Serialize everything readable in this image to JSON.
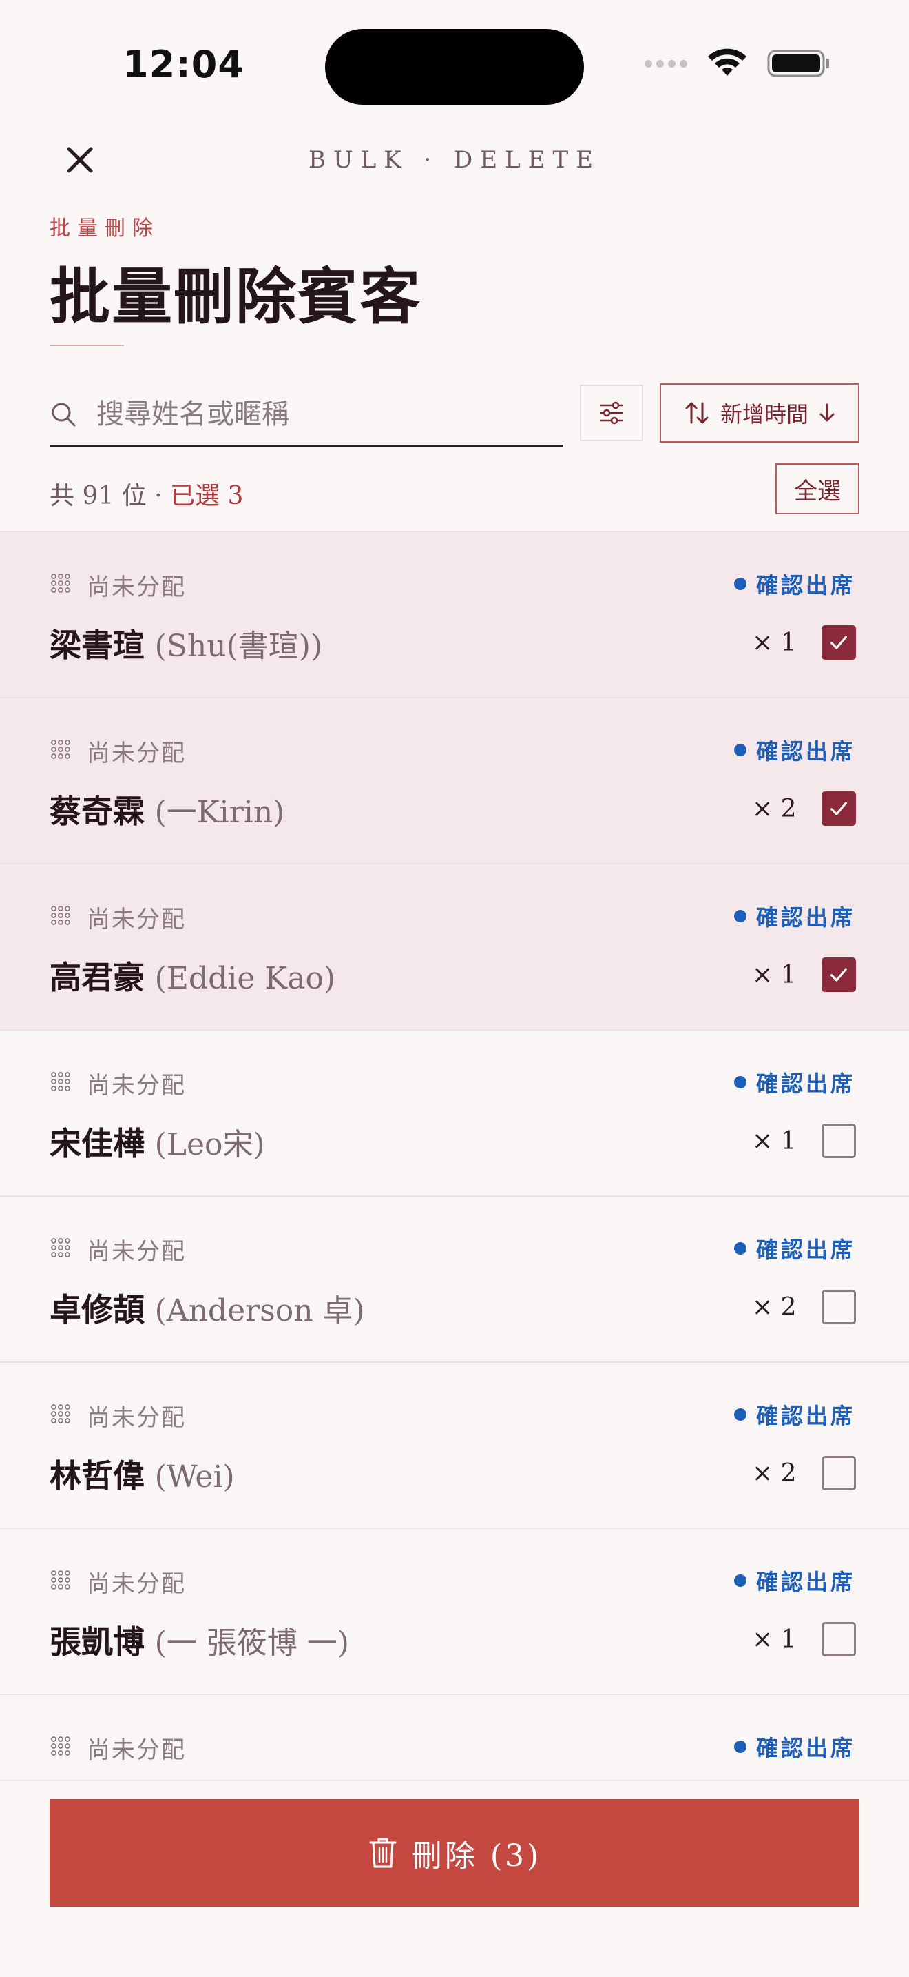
{
  "status_bar": {
    "time": "12:04"
  },
  "header": {
    "eyebrow": "BULK · DELETE",
    "subtitle": "批量刪除",
    "title": "批量刪除賓客"
  },
  "search": {
    "placeholder": "搜尋姓名或暱稱",
    "value": ""
  },
  "sort": {
    "label": "新增時間"
  },
  "summary": {
    "total_text": "共 91 位 · ",
    "selected_text": "已選 3"
  },
  "select_all_label": "全選",
  "guests": [
    {
      "table": "尚未分配",
      "status": "確認出席",
      "name": "梁書瑄",
      "nickname": "(Shu(書瑄))",
      "qty": "× 1",
      "selected": true
    },
    {
      "table": "尚未分配",
      "status": "確認出席",
      "name": "蔡奇霖",
      "nickname": "(一Kirin)",
      "qty": "× 2",
      "selected": true
    },
    {
      "table": "尚未分配",
      "status": "確認出席",
      "name": "高君豪",
      "nickname": "(Eddie Kao)",
      "qty": "× 1",
      "selected": true
    },
    {
      "table": "尚未分配",
      "status": "確認出席",
      "name": "宋佳樺",
      "nickname": "(Leo宋)",
      "qty": "× 1",
      "selected": false
    },
    {
      "table": "尚未分配",
      "status": "確認出席",
      "name": "卓修頡",
      "nickname": "(Anderson 卓)",
      "qty": "× 2",
      "selected": false
    },
    {
      "table": "尚未分配",
      "status": "確認出席",
      "name": "林哲偉",
      "nickname": "(Wei)",
      "qty": "× 2",
      "selected": false
    },
    {
      "table": "尚未分配",
      "status": "確認出席",
      "name": "張凱博",
      "nickname": "(一 張筱博 一)",
      "qty": "× 1",
      "selected": false
    },
    {
      "table": "尚未分配",
      "status": "確認出席",
      "partial": true
    }
  ],
  "delete_button": {
    "label": "刪除 (3)"
  },
  "colors": {
    "accent": "#c44740",
    "selected_bg": "#f5e8ea",
    "check": "#8a2a3a",
    "status_blue": "#1d5fb8"
  }
}
